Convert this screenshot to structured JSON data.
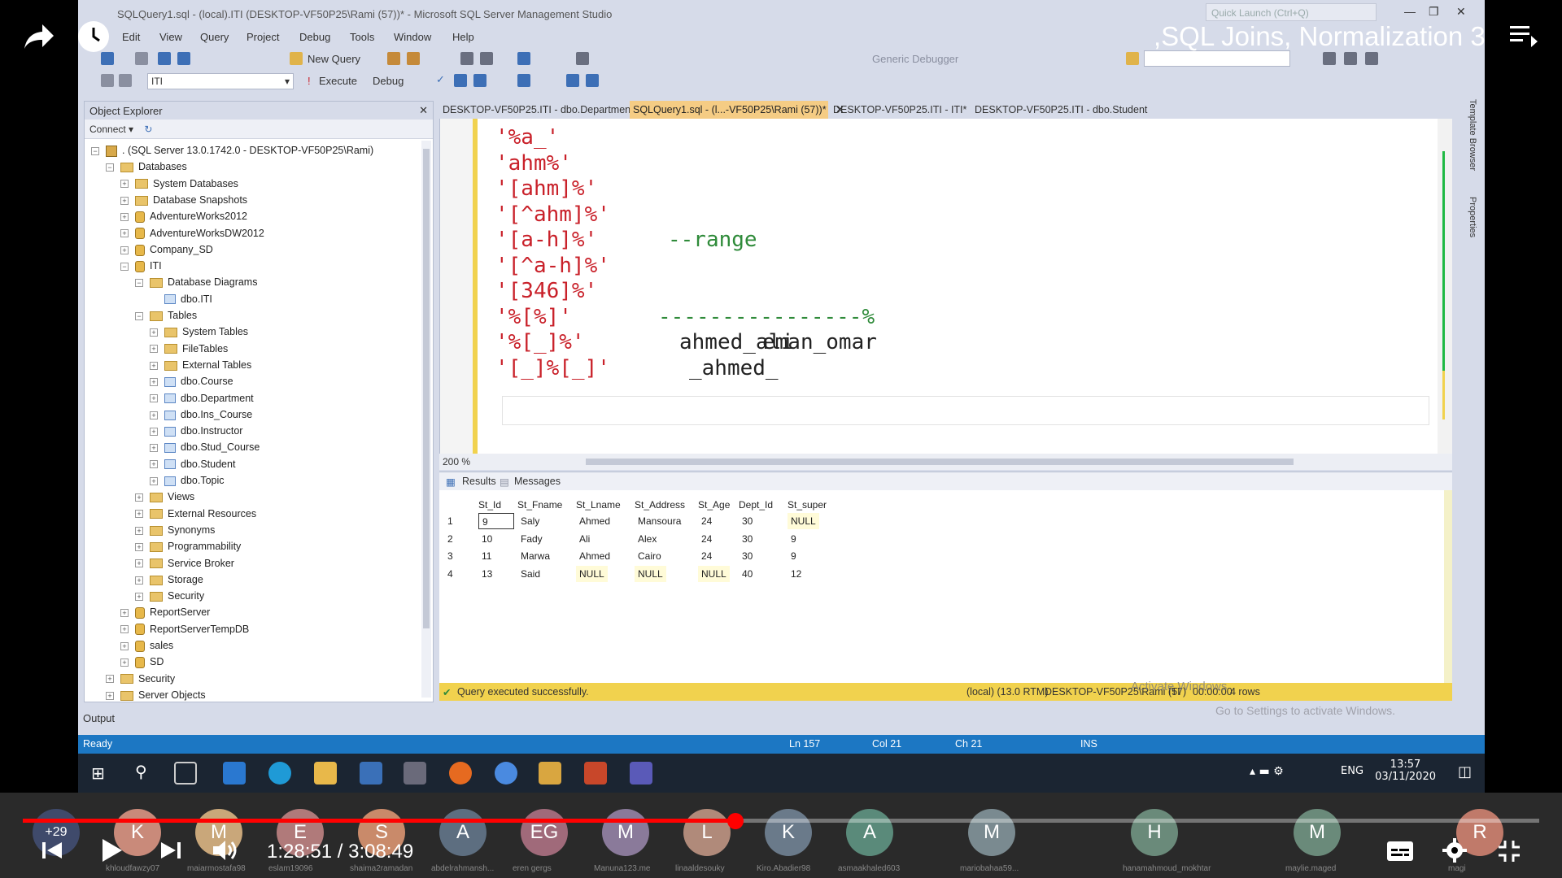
{
  "video": {
    "title": ",SQL Joins, Normalization 3",
    "time_current": "1:28:51",
    "time_separator": "/",
    "time_total": "3:08:49",
    "progress_fraction": 0.47
  },
  "ssms": {
    "window_title": "SQLQuery1.sql - (local).ITI (DESKTOP-VF50P25\\Rami (57))* - Microsoft SQL Server Management Studio",
    "quick_launch_placeholder": "Quick Launch (Ctrl+Q)",
    "menu": [
      "Edit",
      "View",
      "Query",
      "Project",
      "Debug",
      "Tools",
      "Window",
      "Help"
    ],
    "toolbar": {
      "new_query": "New Query",
      "generic_debugger": "Generic Debugger",
      "database": "ITI",
      "execute": "Execute",
      "debug": "Debug"
    },
    "object_explorer": {
      "title": "Object Explorer",
      "connect": "Connect",
      "tree": [
        {
          "label": ". (SQL Server 13.0.1742.0 - DESKTOP-VF50P25\\Rami)",
          "level": 0,
          "exp": "−",
          "icon": "srv"
        },
        {
          "label": "Databases",
          "level": 1,
          "exp": "−",
          "icon": "fold"
        },
        {
          "label": "System Databases",
          "level": 2,
          "exp": "+",
          "icon": "fold"
        },
        {
          "label": "Database Snapshots",
          "level": 2,
          "exp": "+",
          "icon": "fold"
        },
        {
          "label": "AdventureWorks2012",
          "level": 2,
          "exp": "+",
          "icon": "db"
        },
        {
          "label": "AdventureWorksDW2012",
          "level": 2,
          "exp": "+",
          "icon": "db"
        },
        {
          "label": "Company_SD",
          "level": 2,
          "exp": "+",
          "icon": "db"
        },
        {
          "label": "ITI",
          "level": 2,
          "exp": "−",
          "icon": "db"
        },
        {
          "label": "Database Diagrams",
          "level": 3,
          "exp": "−",
          "icon": "fold"
        },
        {
          "label": "dbo.ITI",
          "level": 4,
          "exp": "",
          "icon": "tbl"
        },
        {
          "label": "Tables",
          "level": 3,
          "exp": "−",
          "icon": "fold"
        },
        {
          "label": "System Tables",
          "level": 4,
          "exp": "+",
          "icon": "fold"
        },
        {
          "label": "FileTables",
          "level": 4,
          "exp": "+",
          "icon": "fold"
        },
        {
          "label": "External Tables",
          "level": 4,
          "exp": "+",
          "icon": "fold"
        },
        {
          "label": "dbo.Course",
          "level": 4,
          "exp": "+",
          "icon": "tbl"
        },
        {
          "label": "dbo.Department",
          "level": 4,
          "exp": "+",
          "icon": "tbl"
        },
        {
          "label": "dbo.Ins_Course",
          "level": 4,
          "exp": "+",
          "icon": "tbl"
        },
        {
          "label": "dbo.Instructor",
          "level": 4,
          "exp": "+",
          "icon": "tbl"
        },
        {
          "label": "dbo.Stud_Course",
          "level": 4,
          "exp": "+",
          "icon": "tbl"
        },
        {
          "label": "dbo.Student",
          "level": 4,
          "exp": "+",
          "icon": "tbl"
        },
        {
          "label": "dbo.Topic",
          "level": 4,
          "exp": "+",
          "icon": "tbl"
        },
        {
          "label": "Views",
          "level": 3,
          "exp": "+",
          "icon": "fold"
        },
        {
          "label": "External Resources",
          "level": 3,
          "exp": "+",
          "icon": "fold"
        },
        {
          "label": "Synonyms",
          "level": 3,
          "exp": "+",
          "icon": "fold"
        },
        {
          "label": "Programmability",
          "level": 3,
          "exp": "+",
          "icon": "fold"
        },
        {
          "label": "Service Broker",
          "level": 3,
          "exp": "+",
          "icon": "fold"
        },
        {
          "label": "Storage",
          "level": 3,
          "exp": "+",
          "icon": "fold"
        },
        {
          "label": "Security",
          "level": 3,
          "exp": "+",
          "icon": "fold"
        },
        {
          "label": "ReportServer",
          "level": 2,
          "exp": "+",
          "icon": "db"
        },
        {
          "label": "ReportServerTempDB",
          "level": 2,
          "exp": "+",
          "icon": "db"
        },
        {
          "label": "sales",
          "level": 2,
          "exp": "+",
          "icon": "db"
        },
        {
          "label": "SD",
          "level": 2,
          "exp": "+",
          "icon": "db"
        },
        {
          "label": "Security",
          "level": 1,
          "exp": "+",
          "icon": "fold"
        },
        {
          "label": "Server Objects",
          "level": 1,
          "exp": "+",
          "icon": "fold"
        }
      ]
    },
    "tabs": [
      {
        "label": "DESKTOP-VF50P25.ITI - dbo.Department",
        "active": false
      },
      {
        "label": "SQLQuery1.sql - (l...-VF50P25\\Rami (57))*",
        "active": true
      },
      {
        "label": "DESKTOP-VF50P25.ITI - ITI*",
        "active": false
      },
      {
        "label": "DESKTOP-VF50P25.ITI - dbo.Student",
        "active": false
      }
    ],
    "editor": {
      "lines": [
        {
          "str": "'%a_'",
          "after": "",
          "after_kind": "plain",
          "extra": ""
        },
        {
          "str": "'ahm%'",
          "after": "",
          "after_kind": "plain",
          "extra": ""
        },
        {
          "str": "'[ahm]%'",
          "after": "",
          "after_kind": "plain",
          "extra": ""
        },
        {
          "str": "'[^ahm]%'",
          "after": "",
          "after_kind": "plain",
          "extra": ""
        },
        {
          "str": "'[a-h]%'",
          "after": "--range",
          "after_kind": "cmt",
          "extra": ""
        },
        {
          "str": "'[^a-h]%'",
          "after": "",
          "after_kind": "plain",
          "extra": ""
        },
        {
          "str": "'[346]%'",
          "after": "",
          "after_kind": "plain",
          "extra": ""
        },
        {
          "str": "'%[%]'",
          "after": "----------------%",
          "after_kind": "cmt",
          "extra": ""
        },
        {
          "str": "'%[_]%'",
          "after": "ahmed_ali",
          "after_kind": "plain",
          "extra": "eman_omar"
        },
        {
          "str": "'[_]%[_]'",
          "after": "_ahmed_",
          "after_kind": "plain",
          "extra": ""
        }
      ],
      "zoom": "200 %"
    },
    "results": {
      "tab_results": "Results",
      "tab_messages": "Messages",
      "columns": [
        "St_Id",
        "St_Fname",
        "St_Lname",
        "St_Address",
        "St_Age",
        "Dept_Id",
        "St_super"
      ],
      "rows": [
        {
          "n": "1",
          "cells": [
            "9",
            "Saly",
            "Ahmed",
            "Mansoura",
            "24",
            "30",
            "NULL"
          ]
        },
        {
          "n": "2",
          "cells": [
            "10",
            "Fady",
            "Ali",
            "Alex",
            "24",
            "30",
            "9"
          ]
        },
        {
          "n": "3",
          "cells": [
            "11",
            "Marwa",
            "Ahmed",
            "Cairo",
            "24",
            "30",
            "9"
          ]
        },
        {
          "n": "4",
          "cells": [
            "13",
            "Said",
            "NULL",
            "NULL",
            "NULL",
            "40",
            "12"
          ]
        }
      ]
    },
    "query_status": {
      "message": "Query executed successfully.",
      "server": "(local) (13.0 RTM)",
      "user": "DESKTOP-VF50P25\\Rami (57)",
      "db": "ITI",
      "time": "00:00:00",
      "rows": "4 rows"
    },
    "activate": {
      "line1": "Activate Windows",
      "line2": "Go to Settings to activate Windows."
    },
    "output_label": "Output",
    "statusbar": {
      "ready": "Ready",
      "ln": "Ln 157",
      "col": "Col 21",
      "ch": "Ch 21",
      "ins": "INS"
    },
    "right_panel": {
      "template": "Template Browser",
      "properties": "Properties"
    }
  },
  "taskbar": {
    "lang": "ENG",
    "time": "13:57",
    "date": "03/11/2020"
  },
  "participants": [
    {
      "letter": "+29",
      "name": "",
      "color": "#3f4a6b"
    },
    {
      "letter": "K",
      "name": "khloudfawzy07",
      "color": "#c98a7a"
    },
    {
      "letter": "M",
      "name": "maiarmostafa98",
      "color": "#c9a77a"
    },
    {
      "letter": "E",
      "name": "eslam19096",
      "color": "#b07a7a"
    },
    {
      "letter": "S",
      "name": "shaima2ramadan",
      "color": "#c98a6a"
    },
    {
      "letter": "A",
      "name": "abdelrahmansh...",
      "color": "#5d6e80"
    },
    {
      "letter": "EG",
      "name": "eren gergs",
      "color": "#a06a7a"
    },
    {
      "letter": "M",
      "name": "Manuna123.me",
      "color": "#8a7a9a"
    },
    {
      "letter": "L",
      "name": "linaaldesouky",
      "color": "#b08a7a"
    },
    {
      "letter": "K",
      "name": "Kiro.Abadier98",
      "color": "#6a7a8a"
    },
    {
      "letter": "A",
      "name": "asmaakhaled603",
      "color": "#5a8a7a"
    },
    {
      "letter": "M",
      "name": "mariobahaa59...",
      "color": "#7a8a90"
    },
    {
      "letter": "H",
      "name": "hanamahmoud_mokhtar",
      "color": "#6a8a7a"
    },
    {
      "letter": "M",
      "name": "maylie.maged",
      "color": "#6a8a7a"
    },
    {
      "letter": "R",
      "name": "magi",
      "color": "#c07a6a"
    }
  ]
}
